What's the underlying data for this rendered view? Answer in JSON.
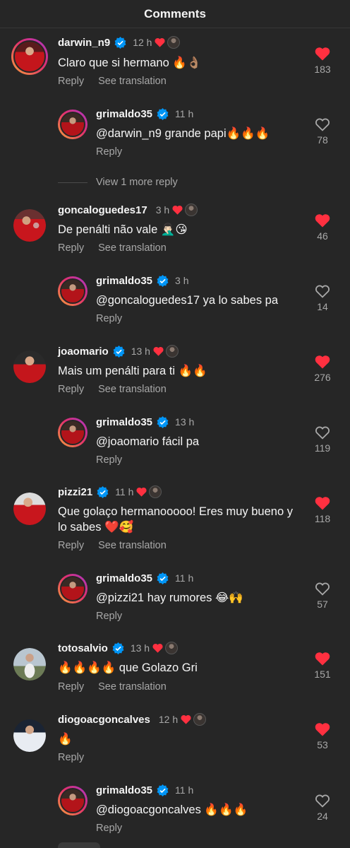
{
  "header": {
    "title": "Comments"
  },
  "labels": {
    "reply": "Reply",
    "see_translation": "See translation",
    "view_more": "View 1 more reply"
  },
  "colors": {
    "like_red": "#ff3040",
    "verified_blue": "#0095f6",
    "background": "#262626"
  },
  "comments": [
    {
      "username": "darwin_n9",
      "time": "12 h",
      "liked_by_author": true,
      "text": "Claro que si hermano 🔥👌🏽",
      "likes": "183",
      "liked": true,
      "translation": true
    },
    {
      "username": "grimaldo35",
      "time": "11 h",
      "liked_by_author": false,
      "text": "@darwin_n9 grande papi🔥🔥🔥",
      "likes": "78",
      "liked": false,
      "translation": false
    },
    {
      "username": "goncaloguedes17",
      "time": "3 h",
      "liked_by_author": true,
      "text": "De penálti não vale 🤦🏻‍♂️😘",
      "likes": "46",
      "liked": true,
      "translation": true
    },
    {
      "username": "grimaldo35",
      "time": "3 h",
      "liked_by_author": false,
      "text": "@goncaloguedes17 ya lo sabes pa",
      "likes": "14",
      "liked": false,
      "translation": false
    },
    {
      "username": "joaomario",
      "time": "13 h",
      "liked_by_author": true,
      "text": "Mais um penálti para ti 🔥🔥",
      "likes": "276",
      "liked": true,
      "translation": true
    },
    {
      "username": "grimaldo35",
      "time": "13 h",
      "liked_by_author": false,
      "text": "@joaomario fácil pa",
      "likes": "119",
      "liked": false,
      "translation": false
    },
    {
      "username": "pizzi21",
      "time": "11 h",
      "liked_by_author": true,
      "text_line1": "Que golaço hermanooooo! Eres muy bueno y",
      "text_line2": "lo sabes ❤️🥰",
      "likes": "118",
      "liked": true,
      "translation": true
    },
    {
      "username": "grimaldo35",
      "time": "11 h",
      "liked_by_author": false,
      "text": "@pizzi21 hay rumores 😂🙌",
      "likes": "57",
      "liked": false,
      "translation": false
    },
    {
      "username": "totosalvio",
      "time": "13 h",
      "liked_by_author": true,
      "text": "🔥🔥🔥🔥 que Golazo Gri",
      "likes": "151",
      "liked": true,
      "translation": true
    },
    {
      "username": "diogoacgoncalves",
      "time": "12 h",
      "liked_by_author": true,
      "text": "🔥",
      "likes": "53",
      "liked": true,
      "translation": false
    },
    {
      "username": "grimaldo35",
      "time": "11 h",
      "liked_by_author": false,
      "text": "@diogoacgoncalves 🔥🔥🔥",
      "likes": "24",
      "liked": false,
      "translation": false
    }
  ]
}
